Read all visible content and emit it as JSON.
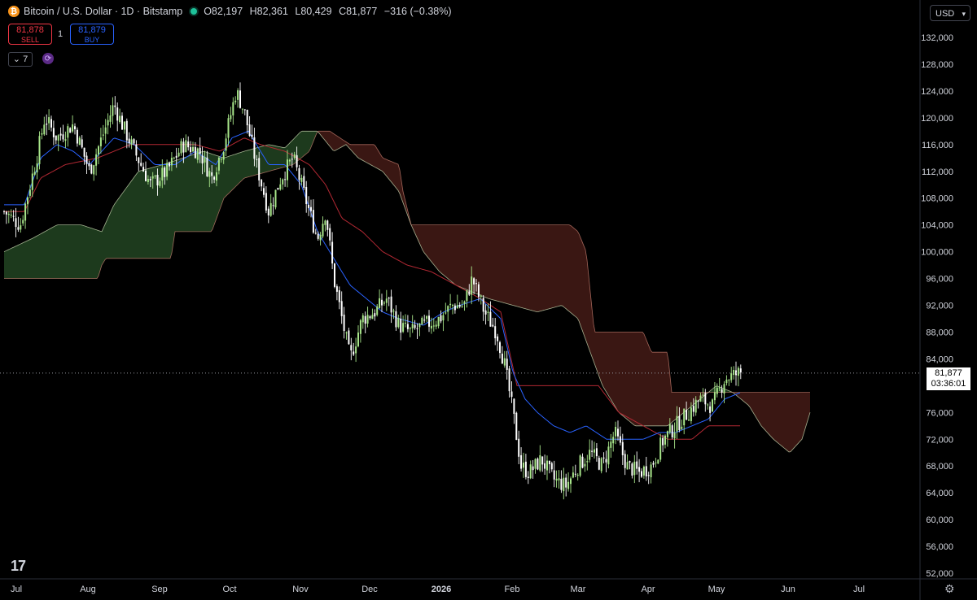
{
  "header": {
    "symbol": "Bitcoin / U.S. Dollar · 1D · Bitstamp",
    "open": "O82,197",
    "high": "H82,361",
    "low": "L80,429",
    "close": "C81,877",
    "change": "−316 (−0.38%)"
  },
  "trade": {
    "sell_price": "81,878",
    "sell_label": "SELL",
    "spread": "1",
    "buy_price": "81,879",
    "buy_label": "BUY"
  },
  "indicators": {
    "count": "7"
  },
  "currency": "USD",
  "current_price": {
    "price": "81,877",
    "countdown": "03:36:01"
  },
  "colors": {
    "up": "#a8e68a",
    "down": "#ffffff",
    "tenkan": "#2962ff",
    "kijun": "#b22833",
    "cloud_bull": "#1d3a1d",
    "cloud_bear": "#3a1713",
    "sell": "#f23645",
    "buy": "#2962ff"
  },
  "chart_data": {
    "type": "candlestick",
    "yticks": [
      "132,000",
      "128,000",
      "124,000",
      "120,000",
      "116,000",
      "112,000",
      "108,000",
      "104,000",
      "100,000",
      "96,000",
      "92,000",
      "88,000",
      "84,000",
      "76,000",
      "72,000",
      "68,000",
      "64,000",
      "60,000",
      "56,000",
      "52,000"
    ],
    "xticks": [
      "Jul",
      "Aug",
      "Sep",
      "Oct",
      "Nov",
      "Dec",
      "2026",
      "Feb",
      "Mar",
      "Apr",
      "May",
      "Jun",
      "Jul"
    ],
    "ylim": [
      51000,
      133000
    ],
    "indicator": "Ichimoku Cloud",
    "key_points": [
      {
        "date": "Jul",
        "close": 107000
      },
      {
        "date": "mid-Jul",
        "close": 119000
      },
      {
        "date": "Aug",
        "close": 116000
      },
      {
        "date": "mid-Aug",
        "close": 122000
      },
      {
        "date": "Sep",
        "close": 109000
      },
      {
        "date": "mid-Sep",
        "close": 116000
      },
      {
        "date": "Oct",
        "close": 125000
      },
      {
        "date": "Nov",
        "close": 104000
      },
      {
        "date": "late-Nov",
        "close": 84000
      },
      {
        "date": "Dec",
        "close": 91000
      },
      {
        "date": "2026",
        "close": 96000
      },
      {
        "date": "Feb",
        "close": 63000
      },
      {
        "date": "Mar",
        "close": 67000
      },
      {
        "date": "Apr",
        "close": 68000
      },
      {
        "date": "May",
        "close": 81877
      }
    ]
  }
}
